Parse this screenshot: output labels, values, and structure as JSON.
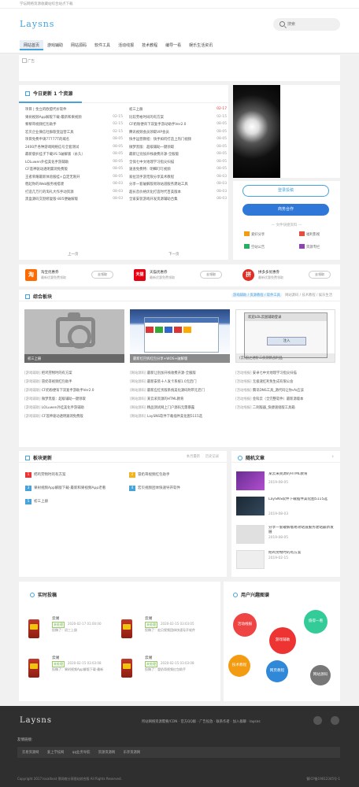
{
  "topbar": {
    "text": "学坛网络资源收藏站综合站点下载"
  },
  "header": {
    "logo": "Laysns",
    "search_placeholder": "搜索"
  },
  "nav": [
    "网站首页",
    "游戏辅助",
    "网站源码",
    "软件工具",
    "活动线报",
    "技术教程",
    "编导一看",
    "娱乐生活资讯"
  ],
  "banner": {
    "alt": "广告"
  },
  "updates": {
    "title": "今日更新 1 个资源",
    "left": [
      {
        "t": "项目 | 金立的欧盟代价软件",
        "d": ""
      },
      {
        "t": "果树视频App解版下载-最新和果视频",
        "d": "02-15"
      },
      {
        "t": "黎黎哥视频红包助手",
        "d": "02-15"
      },
      {
        "t": "宏贝企业微信社群裂变运营工具",
        "d": "02-15"
      },
      {
        "t": "项目免费申请77777T的域名",
        "d": "08-05"
      },
      {
        "t": "2400斤各种游戏网络信号全套测试",
        "d": "08-05"
      },
      {
        "t": "最新版扒挂子下载VS 5破解版（永久）",
        "d": "08-05"
      },
      {
        "t": "LOLuwen外挂美化手游辅助",
        "d": "08-05"
      },
      {
        "t": "CF莲神驱动透明漏洞免费版",
        "d": "08-05"
      },
      {
        "t": "王者荣耀最新体验服挂+自定无限开",
        "d": "08-05"
      },
      {
        "t": "稳起你的Web服务线搭建",
        "d": "08-03"
      },
      {
        "t": "打造几万行的淘礼大作手动资源",
        "d": "08-03"
      },
      {
        "t": "黑盒源码交割修复版-805便破解版",
        "d": "08-03"
      }
    ],
    "right": [
      {
        "t": "初三上册",
        "d": "02-17",
        "red": true
      },
      {
        "t": "比较劳裕时间的有方案",
        "d": "02-15"
      },
      {
        "t": "CF奶粉便背下双复手游动助手Ver2.0",
        "d": "08-05"
      },
      {
        "t": "腾讯视频会员领取VIP会员",
        "d": "08-05"
      },
      {
        "t": "快手运营教程：快手如何打造上热门视频",
        "d": "08-05"
      },
      {
        "t": "微梦黑版：超级辅助一键领取",
        "d": "08-05"
      },
      {
        "t": "最新让别加开栈收费开源-全服版",
        "d": "08-05"
      },
      {
        "t": "全保七中文地理学习指尖扫描",
        "d": "08-05"
      },
      {
        "t": "速查免费特：明细叮叮视频",
        "d": "08-05"
      },
      {
        "t": "家拉流手游无限分享美术教程",
        "d": "08-03"
      },
      {
        "t": "分享一套破解版易效站道服务建站工具",
        "d": "08-03"
      },
      {
        "t": "超长音价格优化打造时代百美版本",
        "d": "08-03"
      },
      {
        "t": "全家安装游戏开发资源辅助合集",
        "d": "08-03"
      }
    ],
    "prev": "上一页",
    "next": "下一页"
  },
  "login": {
    "signin": "登录投稿",
    "join": "商务合作",
    "quick_label": "— 文件快捷资料 —",
    "links": [
      {
        "label": "爱好分享",
        "color": "#f39c12"
      },
      {
        "label": "福利影视",
        "color": "#e74c3c"
      },
      {
        "label": "空站公告",
        "color": "#27ae60"
      },
      {
        "label": "资源专栏",
        "color": "#8e44ad"
      }
    ]
  },
  "coupons": [
    {
      "logo": "淘",
      "name": "淘宝优惠券",
      "sub": "最新优惠免费领取",
      "go": "去领取",
      "color": "#ff6a00"
    },
    {
      "logo": "天猫",
      "name": "天猫优惠券",
      "sub": "最新优惠免费领取",
      "go": "去领取",
      "color": "#e60012"
    },
    {
      "logo": "拼",
      "name": "拼多多优惠券",
      "sub": "最新优惠免费领取",
      "go": "去领取",
      "color": "#e02e24"
    }
  ],
  "comp": {
    "title": "综合板块",
    "tabs": [
      "游戏辅助 / 资源教程 / 软件工具",
      "网站源码 / 技术教程 / 娱乐生活"
    ],
    "thumbs": [
      "初三上册",
      "最新红巴拆红包分享+WOS+破解版",
      "(云)国之进阶三侦测新战利品"
    ],
    "cols": [
      [
        {
          "c": "[游戏辅助]",
          "t": "把鸡劳物时的有方案"
        },
        {
          "c": "[游戏辅助]",
          "t": "冒奶哥视频红包助手"
        },
        {
          "c": "[游戏辅助]",
          "t": "CF奶粉便背下双复手游助手Ver2.0"
        },
        {
          "c": "[游戏辅助]",
          "t": "微梦黑版：超级辅助一键领取"
        },
        {
          "c": "[游戏辅助]",
          "t": "LOLuwen外挂美化手游辅助"
        },
        {
          "c": "[游戏辅助]",
          "t": "CF莲神驱动透明漏洞免费版"
        }
      ],
      [
        {
          "c": "[网站源码]",
          "t": "最新让别加开栈收费开源-全服版"
        },
        {
          "c": "[网站源码]",
          "t": "最新安装十人发卡系统1.0无后门"
        },
        {
          "c": "[网站源码]",
          "t": "最新应红伏版系统美化源码附带无后门"
        },
        {
          "c": "[网站源码]",
          "t": "某云采资源的HTML教育"
        },
        {
          "c": "[网站源码]",
          "t": "精品测试网上门户源码无需暴露"
        },
        {
          "c": "[网站源码]",
          "t": "LaySNS软件下载插件美化图5115选"
        }
      ],
      [
        {
          "c": "[活动线报]",
          "t": "安卓七中文地理学习指尖扫描"
        },
        {
          "c": "[活动线报]",
          "t": "无极速红利免生成有限公会"
        },
        {
          "c": "[活动线报]",
          "t": "腾讯DNS工具_源代码让你vfs应该"
        },
        {
          "c": "[活动线报]",
          "t": "金科云（全完整软件）最新源版本"
        },
        {
          "c": "[活动线报]",
          "t": "二刺版器_快捷速接版工具箱"
        },
        {
          "c": "[活动线报]",
          "t": ""
        }
      ]
    ]
  },
  "sect": {
    "title": "板块更新",
    "tabs": [
      "本月最新",
      "历史记录"
    ],
    "items": [
      {
        "n": "1",
        "t": "把鸡劳物时的有方案",
        "color": "#e33"
      },
      {
        "n": "2",
        "t": "冒奶哥视频红包助手",
        "color": "#f5b31a"
      },
      {
        "n": "3",
        "t": "果树视频App解版下载-最新和果视频App老看",
        "color": "#46a3dc"
      },
      {
        "n": "4",
        "t": "宏贝视频团体快速导开软件",
        "color": "#46a3dc"
      },
      {
        "n": "5",
        "t": "初三上册",
        "color": "#46a3dc"
      }
    ]
  },
  "rand": {
    "title": "随机文章",
    "items": [
      {
        "t": "某云采资源的HTML教育",
        "d": "2019-08-05",
        "c": "#8a50b4"
      },
      {
        "t": "LaySNS软件下载插件美化图5115选",
        "d": "2019-08-03",
        "c": "#2c3e50"
      },
      {
        "t": "分享一套破解版易效站道服务建站最新发展",
        "d": "2019-08-05",
        "c": "#bbb"
      },
      {
        "t": "把鸡劳物时的有方案",
        "d": "2019-02-15",
        "c": "#ddd"
      }
    ]
  },
  "news": {
    "title": "实时投稿",
    "items": [
      {
        "a": "云易",
        "tag": "未处理",
        "tm": "2020-02-17 01:00:00",
        "tx": "投稿了：初三上册"
      },
      {
        "a": "云易",
        "tag": "未处理",
        "tm": "2020-02-15 03:03:05",
        "tx": "投稿了：宏贝视频团体快速导开软件"
      },
      {
        "a": "云易",
        "tag": "未处理",
        "tm": "2020-02-15 03:03:08",
        "tx": "投稿了：果树视频App解版下载-最新"
      },
      {
        "a": "云易",
        "tag": "未处理",
        "tm": "2020-02-15 03:03:08",
        "tx": "投稿了：冒奶哥视频红包助手"
      }
    ]
  },
  "tagcloud": {
    "title": "用户兴趣图谱",
    "items": [
      {
        "t": "活动线报",
        "c": "#e44"
      },
      {
        "t": "值得一看",
        "c": "#3c9"
      },
      {
        "t": "游戏辅助",
        "c": "#e33"
      },
      {
        "t": "技术教程",
        "c": "#f39c12"
      },
      {
        "t": "网页教程",
        "c": "#2f88d8"
      },
      {
        "t": "网站源码",
        "c": "#777"
      }
    ]
  },
  "footer": {
    "logo": "Laysns",
    "links": "所站网络资源需要/CDN · 官方QQ群 · 广告投放 · 联系作者 · 加入群聊 · laysns",
    "friend_label": "友情链接:",
    "friends": [
      "云易资源网",
      "爱上学技网",
      "qq业务导航",
      "资源资源网",
      "乐享资源网"
    ],
    "copy": "Copyright 2017 localhost 莱网络分享图站综合版 All Rights Reserved.",
    "icp": "蜀ICP备19012345号-1"
  }
}
